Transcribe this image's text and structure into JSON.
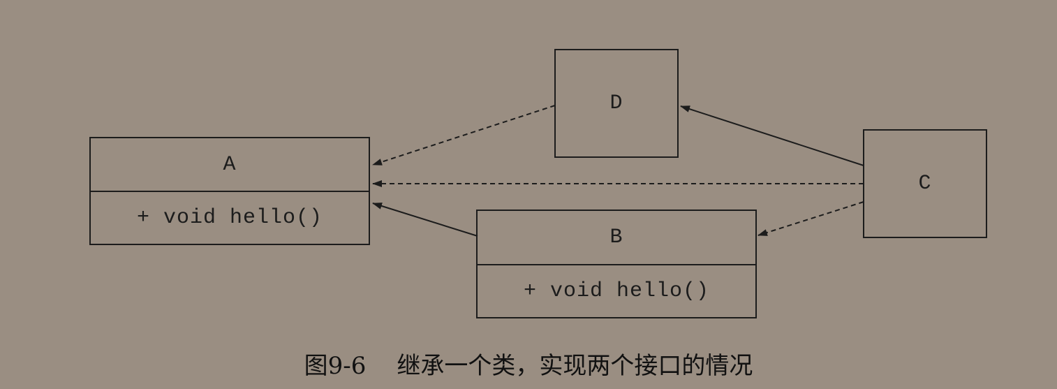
{
  "diagram": {
    "classes": {
      "A": {
        "name": "A",
        "method": "+ void hello()"
      },
      "B": {
        "name": "B",
        "method": "+ void hello()"
      },
      "C": {
        "name": "C"
      },
      "D": {
        "name": "D"
      }
    },
    "edges": [
      {
        "from": "D",
        "to": "A",
        "style": "dashed"
      },
      {
        "from": "C",
        "to": "A",
        "style": "dashed"
      },
      {
        "from": "B",
        "to": "A",
        "style": "solid"
      },
      {
        "from": "C",
        "to": "D",
        "style": "solid"
      },
      {
        "from": "C",
        "to": "B",
        "style": "dashed"
      }
    ],
    "colors": {
      "background": "#9a8e82",
      "ink": "#1c1c1c"
    }
  },
  "caption": {
    "number": "图9-6",
    "text": "继承一个类，实现两个接口的情况"
  }
}
